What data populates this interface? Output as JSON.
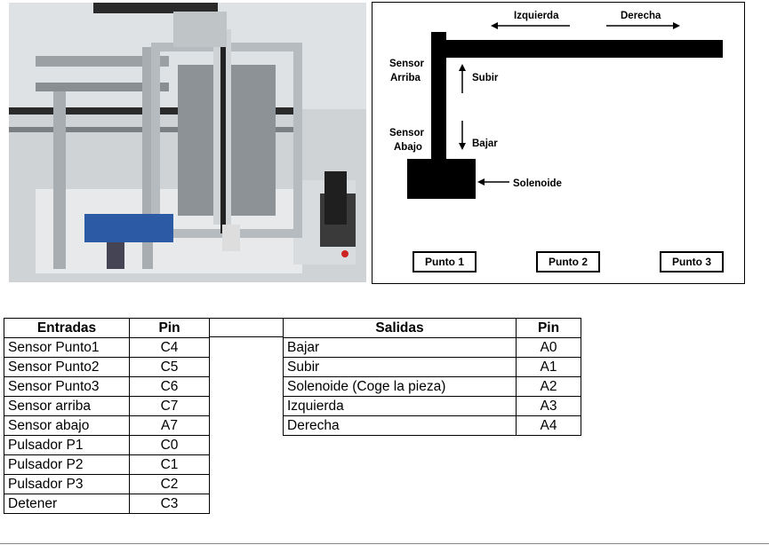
{
  "diagram": {
    "labels": {
      "izquierda": "Izquierda",
      "derecha": "Derecha",
      "sensor_arriba_1": "Sensor",
      "sensor_arriba_2": "Arriba",
      "subir": "Subir",
      "sensor_abajo_1": "Sensor",
      "sensor_abajo_2": "Abajo",
      "bajar": "Bajar",
      "solenoide": "Solenoide"
    },
    "points": [
      "Punto 1",
      "Punto 2",
      "Punto 3"
    ]
  },
  "inputs_table": {
    "headers": [
      "Entradas",
      "Pin"
    ],
    "rows": [
      [
        "Sensor Punto1",
        "C4"
      ],
      [
        "Sensor Punto2",
        "C5"
      ],
      [
        "Sensor Punto3",
        "C6"
      ],
      [
        "Sensor arriba",
        "C7"
      ],
      [
        "Sensor abajo",
        "A7"
      ],
      [
        "Pulsador P1",
        "C0"
      ],
      [
        "Pulsador P2",
        "C1"
      ],
      [
        "Pulsador P3",
        "C2"
      ],
      [
        "Detener",
        "C3"
      ]
    ]
  },
  "outputs_table": {
    "headers": [
      "Salidas",
      "Pin"
    ],
    "rows": [
      [
        "Bajar",
        "A0"
      ],
      [
        "Subir",
        "A1"
      ],
      [
        "Solenoide (Coge la pieza)",
        "A2"
      ],
      [
        "Izquierda",
        "A3"
      ],
      [
        "Derecha",
        "A4"
      ]
    ]
  }
}
